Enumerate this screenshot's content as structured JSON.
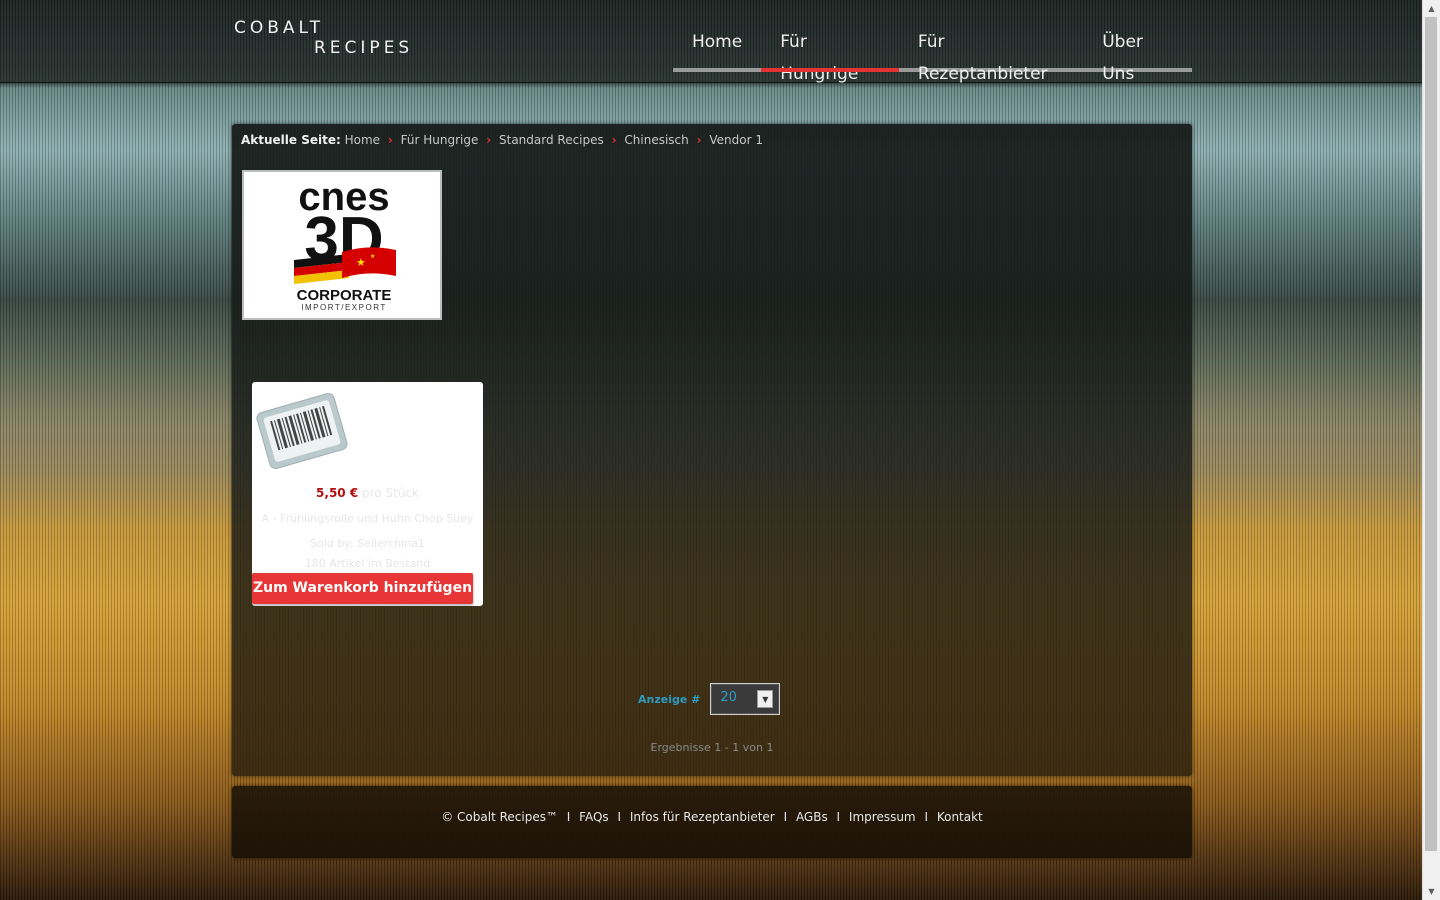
{
  "header": {
    "logo_line1": "COBALT",
    "logo_line2": "RECIPES",
    "nav": [
      {
        "label": "Home",
        "active": false
      },
      {
        "label": "Für Hungrige",
        "active": true
      },
      {
        "label": "Für Rezeptanbieter",
        "active": false
      },
      {
        "label": "Über Uns",
        "active": false
      }
    ]
  },
  "breadcrumb": {
    "lead": "Aktuelle Seite:",
    "items": [
      "Home",
      "Für Hungrige",
      "Standard Recipes",
      "Chinesisch",
      "Vendor 1"
    ]
  },
  "vendor_logo": {
    "line1": "cnes",
    "line2": "3D",
    "line3": "CORPORATE",
    "line4": "IMPORT/EXPORT"
  },
  "product": {
    "price": "5,50 €",
    "unit": "pro Stück",
    "name": "A - Frühlingsrolle und Huhn Chop Suey",
    "seller": "Sold by: Sellerchina1",
    "stock": "180 Artikel im Bestand",
    "cart_button": "Zum Warenkorb hinzufügen"
  },
  "pagination": {
    "label": "Anzeige #",
    "value": "20",
    "results": "Ergebnisse 1 - 1 von 1"
  },
  "footer": {
    "copyright": "© Cobalt Recipes™",
    "links": [
      "FAQs",
      "Infos für Rezeptanbieter",
      "AGBs",
      "Impressum",
      "Kontakt"
    ]
  },
  "colors": {
    "accent_red": "#e23232",
    "price_red": "#b01010",
    "link_blue": "#2f9bc0"
  },
  "icons": [
    "barcode-icon",
    "chevron-down-icon",
    "scroll-up-icon",
    "scroll-down-icon"
  ]
}
